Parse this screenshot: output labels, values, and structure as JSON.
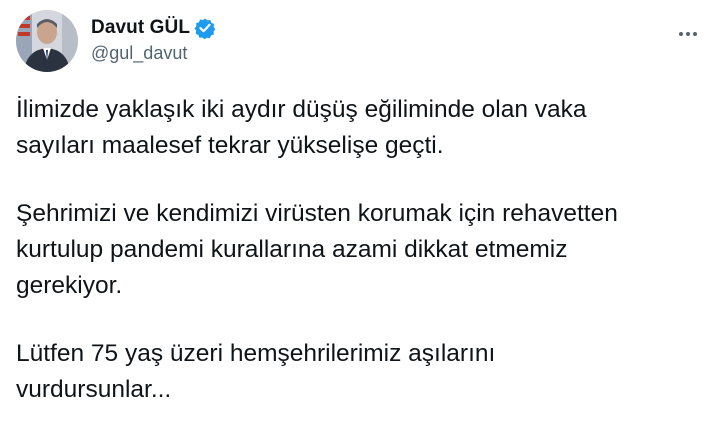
{
  "author": {
    "display_name": "Davut GÜL",
    "handle": "@gul_davut",
    "verified": true
  },
  "tweet": {
    "paragraphs": [
      [
        "İlimizde yaklaşık iki aydır düşüş eğiliminde olan vaka",
        "sayıları maalesef tekrar yükselişe geçti."
      ],
      [
        "Şehrimizi ve kendimizi virüsten korumak için rehavetten",
        "kurtulup pandemi kurallarına azami dikkat etmemiz",
        "gerekiyor."
      ],
      [
        "Lütfen 75 yaş üzeri hemşehrilerimiz aşılarını",
        "vurdursunlar..."
      ]
    ]
  },
  "icons": {
    "verified": "verified-badge-icon",
    "more": "more-options-icon"
  },
  "colors": {
    "verified_blue": "#1d9bf0",
    "text": "#0f1419",
    "secondary": "#536471"
  }
}
